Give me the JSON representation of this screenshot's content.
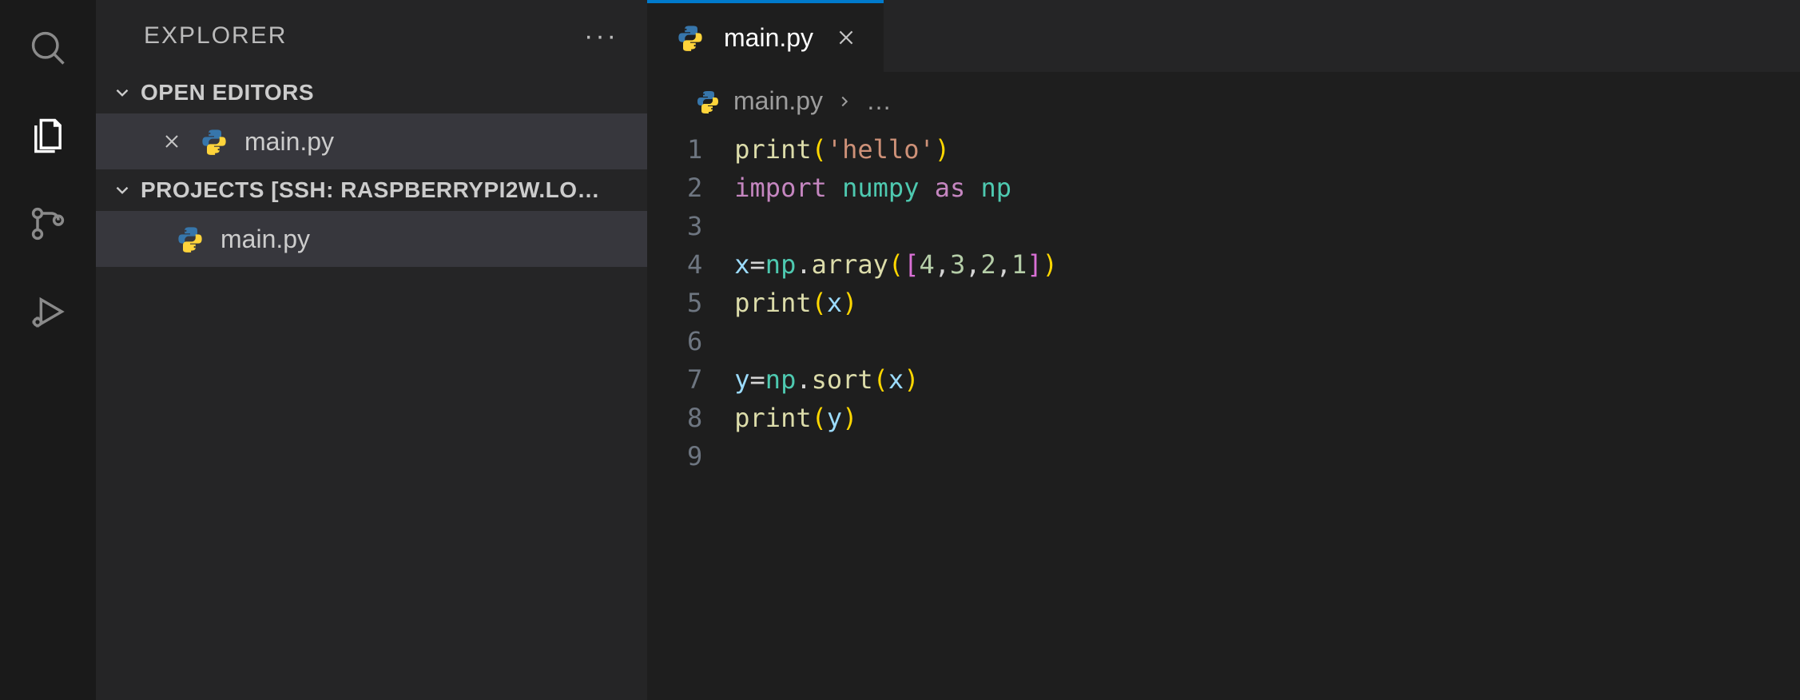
{
  "sidebar": {
    "title": "EXPLORER",
    "sections": {
      "open_editors": {
        "label": "OPEN EDITORS",
        "items": [
          {
            "filename": "main.py"
          }
        ]
      },
      "workspace": {
        "label": "PROJECTS [SSH: RASPBERRYPI2W.LO…",
        "items": [
          {
            "filename": "main.py"
          }
        ]
      }
    }
  },
  "editor": {
    "tab": {
      "filename": "main.py"
    },
    "breadcrumb": {
      "filename": "main.py",
      "ellipsis": "…"
    },
    "lines": [
      "1",
      "2",
      "3",
      "4",
      "5",
      "6",
      "7",
      "8",
      "9"
    ],
    "code": {
      "l1": {
        "fn": "print",
        "open": "(",
        "str": "'hello'",
        "close": ")"
      },
      "l2": {
        "kw1": "import",
        "sp1": " ",
        "mod": "numpy",
        "sp2": " ",
        "kw2": "as",
        "sp3": " ",
        "alias": "np"
      },
      "l4": {
        "var": "x",
        "eq": "=",
        "ns": "np",
        "dot": ".",
        "fn": "array",
        "open": "(",
        "b2": "[",
        "n1": "4",
        "c1": ",",
        "n2": "3",
        "c2": ",",
        "n3": "2",
        "c3": ",",
        "n4": "1",
        "b2c": "]",
        "close": ")"
      },
      "l5": {
        "fn": "print",
        "open": "(",
        "var": "x",
        "close": ")"
      },
      "l7": {
        "var": "y",
        "eq": "=",
        "ns": "np",
        "dot": ".",
        "fn": "sort",
        "open": "(",
        "arg": "x",
        "close": ")"
      },
      "l8": {
        "fn": "print",
        "open": "(",
        "var": "y",
        "close": ")"
      }
    }
  }
}
